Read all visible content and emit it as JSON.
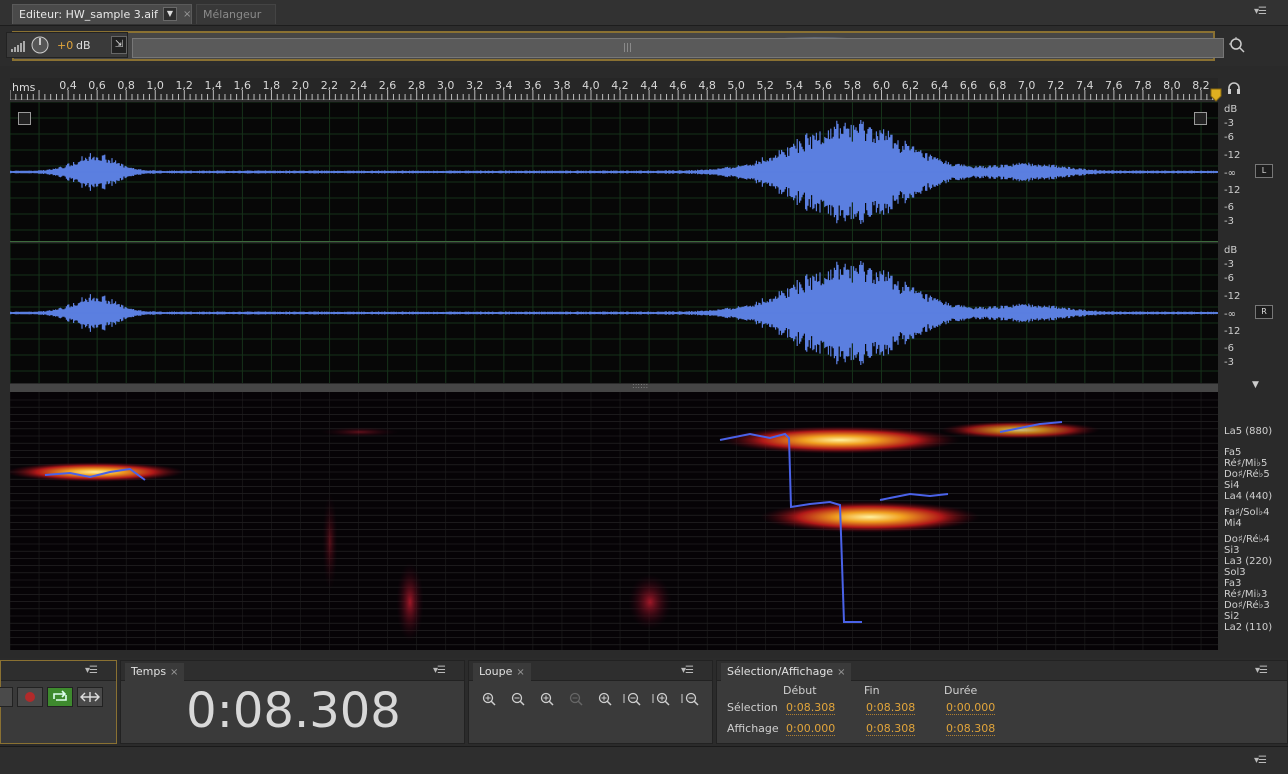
{
  "tabs": {
    "editor_label": "Editeur: HW_sample 3.aif",
    "mixer_label": "Mélangeur"
  },
  "overview": {
    "volume_value": "+0",
    "volume_unit": "dB"
  },
  "ruler": {
    "unit_label": "hms",
    "ticks": [
      "0,4",
      "0,6",
      "0,8",
      "1,0",
      "1,2",
      "1,4",
      "1,6",
      "1,8",
      "2,0",
      "2,2",
      "2,4",
      "2,6",
      "2,8",
      "3,0",
      "3,2",
      "3,4",
      "3,6",
      "3,8",
      "4,0",
      "4,2",
      "4,4",
      "4,6",
      "4,8",
      "5,0",
      "5,2",
      "5,4",
      "5,6",
      "5,8",
      "6,0",
      "6,2",
      "6,4",
      "6,6",
      "6,8",
      "7,0",
      "7,2",
      "7,4",
      "7,6",
      "7,8",
      "8,0",
      "8,2"
    ]
  },
  "channels": {
    "left_label": "L",
    "right_label": "R",
    "db_labels": [
      "dB",
      "-3",
      "-6",
      "-12",
      "-∞",
      "-12",
      "-6",
      "-3"
    ]
  },
  "pitch_labels": [
    "La5 (880)",
    "Fa5",
    "Ré♯/Mi♭5",
    "Do♯/Ré♭5",
    "Si4",
    "La4 (440)",
    "Fa♯/Sol♭4",
    "Mi4",
    "Do♯/Ré♭4",
    "Si3",
    "La3 (220)",
    "Sol3",
    "Fa3",
    "Ré♯/Mi♭3",
    "Do♯/Ré♭3",
    "Si2",
    "La2 (110)"
  ],
  "panels": {
    "time": {
      "title": "Temps",
      "value": "0:08.308"
    },
    "zoom": {
      "title": "Loupe"
    },
    "selection": {
      "title": "Sélection/Affichage",
      "col_start": "Début",
      "col_end": "Fin",
      "col_duration": "Durée",
      "row_selection": "Sélection",
      "row_view": "Affichage",
      "sel_start": "0:08.308",
      "sel_end": "0:08.308",
      "sel_duration": "0:00.000",
      "view_start": "0:00.000",
      "view_end": "0:08.308",
      "view_duration": "0:08.308"
    }
  },
  "colors": {
    "waveform": "#5b7fe0",
    "selection_accent": "#e0a43a",
    "pitch_line": "#4a62e8"
  },
  "icons": [
    "menu-icon",
    "volume-knob-icon",
    "pin-icon",
    "zoom-navigator-icon",
    "headphones-icon",
    "record-icon",
    "loop-icon",
    "skip-icon",
    "zoom-in-amplitude-icon",
    "zoom-out-amplitude-icon",
    "zoom-in-time-icon",
    "zoom-out-time-icon",
    "zoom-full-icon",
    "zoom-in-selection-icon",
    "zoom-out-selection-icon",
    "zoom-to-selection-icon"
  ]
}
